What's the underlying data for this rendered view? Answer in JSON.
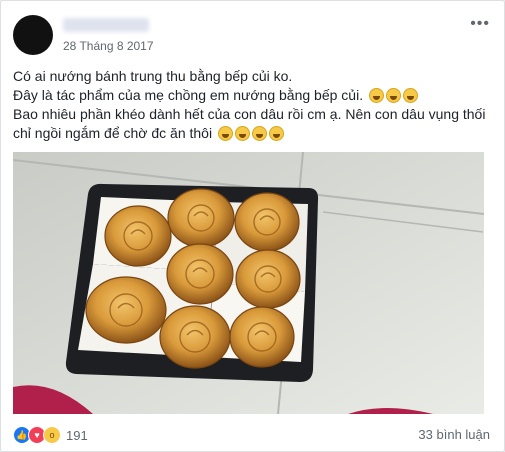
{
  "post": {
    "timestamp": "28 Tháng 8 2017",
    "menu_icon": "more-options-icon",
    "lines": [
      "Có ai nướng bánh trung thu bằng bếp củi ko.",
      "Đây là tác phẩm của mẹ chồng em nướng bằng bếp củi.",
      "Bao nhiêu phần khéo dành hết của con dâu rồi cm ạ. Nên con dâu vụng thối",
      "chỉ ngồi ngắm để chờ đc ăn thôi"
    ],
    "emoji": "laughing-emoji-icon"
  },
  "footer": {
    "reaction_count": "191",
    "comments": "33 bình luận",
    "reaction_icons": [
      "like-icon",
      "love-icon",
      "wow-icon"
    ]
  },
  "colors": {
    "text": "#1d2129",
    "meta": "#616770",
    "like": "#1877f2",
    "love": "#f33e58"
  }
}
